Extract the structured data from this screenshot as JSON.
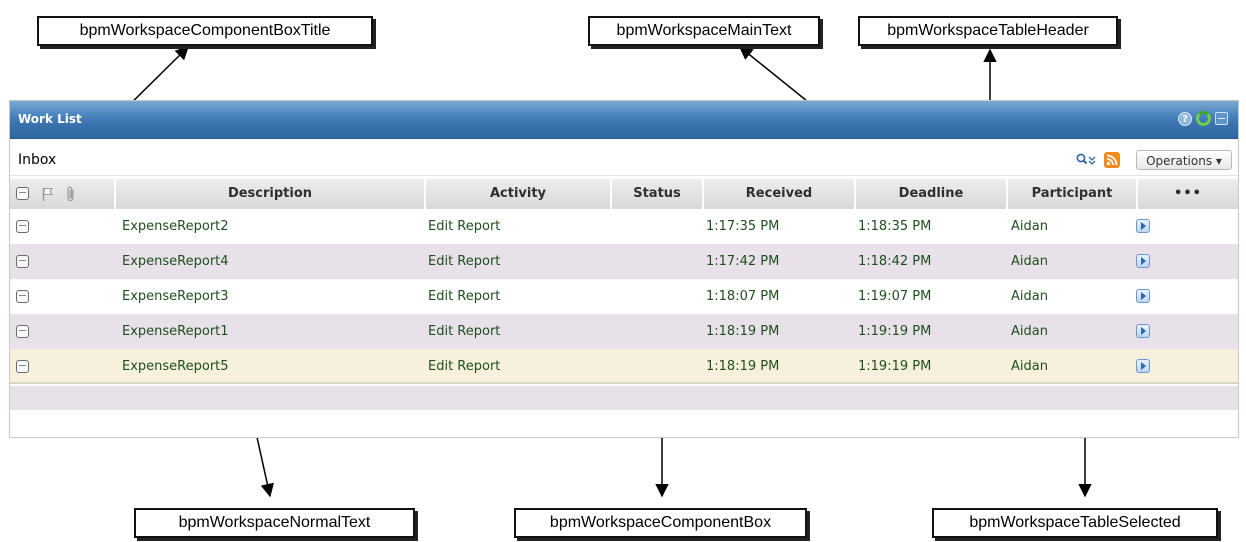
{
  "callouts": {
    "component_box_title": "bpmWorkspaceComponentBoxTitle",
    "main_text": "bpmWorkspaceMainText",
    "table_header": "bpmWorkspaceTableHeader",
    "normal_text": "bpmWorkspaceNormalText",
    "component_box": "bpmWorkspaceComponentBox",
    "table_selected": "bpmWorkspaceTableSelected"
  },
  "panel": {
    "title": "Work List",
    "icons": [
      "help-icon",
      "refresh-icon",
      "minimize-icon"
    ],
    "title_color": "#3a73af"
  },
  "toolbar": {
    "inbox_label": "Inbox",
    "operations_label": "Operations ▾",
    "icons": [
      "search-icon",
      "rss-icon"
    ]
  },
  "table": {
    "columns": [
      "Description",
      "Activity",
      "Status",
      "Received",
      "Deadline",
      "Participant",
      "•••"
    ],
    "header_icons": [
      "select-all-checkbox",
      "flag-icon",
      "attachment-icon"
    ],
    "rows": [
      {
        "description": "ExpenseReport2",
        "activity": "Edit Report",
        "status": "",
        "received": "1:17:35 PM",
        "deadline": "1:18:35 PM",
        "participant": "Aidan"
      },
      {
        "description": "ExpenseReport4",
        "activity": "Edit Report",
        "status": "",
        "received": "1:17:42 PM",
        "deadline": "1:18:42 PM",
        "participant": "Aidan"
      },
      {
        "description": "ExpenseReport3",
        "activity": "Edit Report",
        "status": "",
        "received": "1:18:07 PM",
        "deadline": "1:19:07 PM",
        "participant": "Aidan"
      },
      {
        "description": "ExpenseReport1",
        "activity": "Edit Report",
        "status": "",
        "received": "1:18:19 PM",
        "deadline": "1:19:19 PM",
        "participant": "Aidan"
      },
      {
        "description": "ExpenseReport5",
        "activity": "Edit Report",
        "status": "",
        "received": "1:18:19 PM",
        "deadline": "1:19:19 PM",
        "participant": "Aidan"
      }
    ],
    "selected_row_index": 4,
    "colors": {
      "text": "#1e4f1e",
      "alt_row": "#e9e1ea",
      "selected_row": "#f6f0dd",
      "header_bg": "#dcdcdc"
    }
  }
}
